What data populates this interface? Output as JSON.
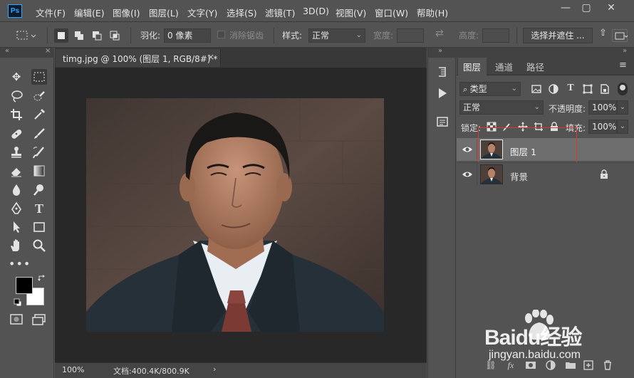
{
  "app": {
    "logo": "Ps"
  },
  "menu": [
    "文件(F)",
    "编辑(E)",
    "图像(I)",
    "图层(L)",
    "文字(Y)",
    "选择(S)",
    "滤镜(T)",
    "3D(D)",
    "视图(V)",
    "窗口(W)",
    "帮助(H)"
  ],
  "window_controls": {
    "minimize": "—",
    "maximize": "▢",
    "close": "✕"
  },
  "options": {
    "feather_label": "羽化:",
    "feather_value": "0 像素",
    "antialias_label": "消除锯齿",
    "style_label": "样式:",
    "style_value": "正常",
    "width_label": "宽度:",
    "height_label": "高度:",
    "select_mask_button": "选择并遮住 ..."
  },
  "document": {
    "tab_title": "timg.jpg @ 100% (图层 1, RGB/8#) *",
    "zoom": "100%",
    "doc_size": "文档:400.4K/800.9K"
  },
  "layers_panel": {
    "tabs": [
      "图层",
      "通道",
      "路径"
    ],
    "filter_kind": "类型",
    "blend_mode": "正常",
    "opacity_label": "不透明度:",
    "opacity_value": "100%",
    "lock_label": "锁定:",
    "fill_label": "填充:",
    "fill_value": "100%",
    "layers": [
      {
        "name": "图层 1",
        "selected": true,
        "locked": false
      },
      {
        "name": "背景",
        "selected": false,
        "locked": true
      }
    ]
  },
  "watermark": {
    "brand": "Baidu经验",
    "url": "jingyan.baidu.com"
  },
  "colors": {
    "highlight_box": "#e0392b",
    "selected_layer": "#6e6e6e"
  }
}
